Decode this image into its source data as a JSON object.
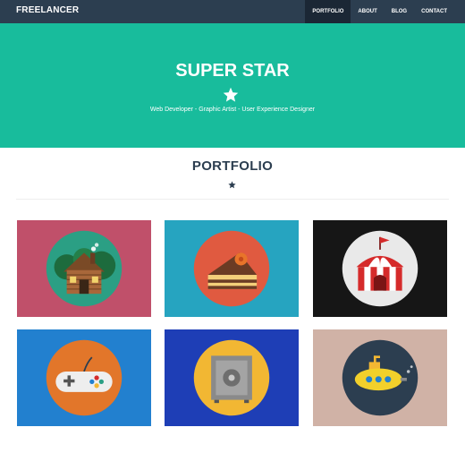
{
  "navbar": {
    "brand": "FREELANCER",
    "links": [
      {
        "label": "PORTFOLIO",
        "active": true
      },
      {
        "label": "ABOUT",
        "active": false
      },
      {
        "label": "BLOG",
        "active": false
      },
      {
        "label": "CONTACT",
        "active": false
      }
    ]
  },
  "hero": {
    "title": "SUPER STAR",
    "icon": "star-icon",
    "subtitle": "Web Developer - Graphic Artist - User Experience Designer"
  },
  "portfolio": {
    "title": "PORTFOLIO",
    "icon": "star-icon",
    "items": [
      {
        "icon": "cabin-icon",
        "background": "#c0506a"
      },
      {
        "icon": "cake-icon",
        "background": "#26a4c0"
      },
      {
        "icon": "circus-tent-icon",
        "background": "#161616"
      },
      {
        "icon": "game-controller-icon",
        "background": "#2280cf"
      },
      {
        "icon": "safe-icon",
        "background": "#1e3eb6"
      },
      {
        "icon": "submarine-icon",
        "background": "#d0b2a6"
      }
    ]
  },
  "colors": {
    "primary": "#2c3e50",
    "accent": "#18bc9c"
  }
}
